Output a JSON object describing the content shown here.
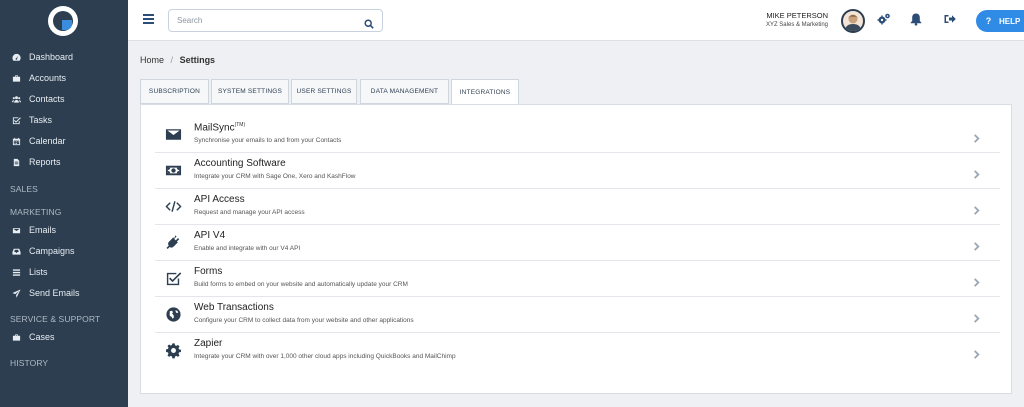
{
  "sidebar": {
    "items": [
      {
        "label": "Dashboard",
        "icon": "dashboard-icon"
      },
      {
        "label": "Accounts",
        "icon": "briefcase-icon"
      },
      {
        "label": "Contacts",
        "icon": "users-icon"
      },
      {
        "label": "Tasks",
        "icon": "checkbox-icon"
      },
      {
        "label": "Calendar",
        "icon": "calendar-icon"
      },
      {
        "label": "Reports",
        "icon": "reports-icon"
      }
    ],
    "sales_heading": "SALES",
    "marketing_heading": "MARKETING",
    "marketing_items": [
      {
        "label": "Emails",
        "icon": "envelope-icon"
      },
      {
        "label": "Campaigns",
        "icon": "campaign-icon"
      },
      {
        "label": "Lists",
        "icon": "list-icon"
      },
      {
        "label": "Send Emails",
        "icon": "send-icon"
      }
    ],
    "service_heading": "SERVICE & SUPPORT",
    "service_items": [
      {
        "label": "Cases",
        "icon": "briefcase-icon"
      }
    ],
    "history_heading": "HISTORY"
  },
  "topbar": {
    "search_placeholder": "Search",
    "user_name": "MIKE PETERSON",
    "user_org": "XYZ Sales & Marketing",
    "help_label": "HELP"
  },
  "breadcrumb": {
    "home": "Home",
    "separator": "/",
    "current": "Settings"
  },
  "tabs": [
    {
      "label": "SUBSCRIPTION",
      "active": false
    },
    {
      "label": "SYSTEM SETTINGS",
      "active": false
    },
    {
      "label": "USER SETTINGS",
      "active": false
    },
    {
      "label": "DATA MANAGEMENT",
      "active": false
    },
    {
      "label": "INTEGRATIONS",
      "active": true
    }
  ],
  "integrations": [
    {
      "title": "MailSync",
      "badge": "(TM)",
      "desc": "Synchronise your emails to and from your Contacts",
      "icon": "envelope-icon"
    },
    {
      "title": "Accounting Software",
      "badge": "",
      "desc": "Integrate your CRM with Sage One, Xero and KashFlow",
      "icon": "money-icon"
    },
    {
      "title": "API Access",
      "badge": "",
      "desc": "Request and manage your API access",
      "icon": "code-icon"
    },
    {
      "title": "API V4",
      "badge": "",
      "desc": "Enable and integrate with our V4 API",
      "icon": "plug-icon"
    },
    {
      "title": "Forms",
      "badge": "",
      "desc": "Build forms to embed on your website and automatically update your CRM",
      "icon": "checkbox-icon"
    },
    {
      "title": "Web Transactions",
      "badge": "",
      "desc": "Configure your CRM to collect data from your website and other applications",
      "icon": "globe-icon"
    },
    {
      "title": "Zapier",
      "badge": "",
      "desc": "Integrate your CRM with over 1,000 other cloud apps including QuickBooks and MailChimp",
      "icon": "gear-icon"
    }
  ],
  "colors": {
    "sidebar_bg": "#2c3e50",
    "accent": "#2f8be6",
    "page_bg": "#eef0f3"
  }
}
